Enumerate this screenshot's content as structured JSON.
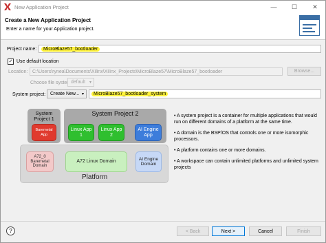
{
  "window": {
    "title": "New Application Project",
    "controls": [
      "—",
      "☐",
      "✕"
    ]
  },
  "header": {
    "title": "Create a New Application Project",
    "subtitle": "Enter a name for your Application project."
  },
  "form": {
    "project_name_label": "Project name:",
    "project_name_value": "MicroBlaze57_bootloader",
    "use_default_location_label": "Use default location",
    "use_default_location_checked": true,
    "location_label": "Location:",
    "location_value": "C:\\Users\\rynea\\Documents\\Xilinx\\Xilinx_Projects\\MicroBlaze57\\MicroBlaze57_bootloader",
    "browse_label": "Browse...",
    "file_system_label": "Choose file system:",
    "file_system_value": "default",
    "system_project_label": "System project:",
    "system_project_select": "Create New...",
    "system_project_value": "MicroBlaze57_bootloader_system"
  },
  "diagram": {
    "system_project_1": "System Project 1",
    "system_project_2": "System Project 2",
    "baremetal_app": "Baremetal App",
    "linux_app_1": "Linux App 1",
    "linux_app_2": "Linux App 2",
    "ai_engine_app": "AI Engine App",
    "a72_baremetal_domain": "A72_0 Baremetal Domain",
    "a72_linux_domain": "A72 Linux Domain",
    "ai_engine_domain": "AI Engine Domain",
    "platform": "Platform"
  },
  "bullets": [
    "• A system project is a container for multiple applications that would run on different domains of a platform at the same time.",
    "• A domain is the BSP/OS that controls one or more isomorphic processors.",
    "• A platform contains one or more domains.",
    "• A workspace can contain unlimited platforms and unlimited system projects"
  ],
  "footer": {
    "help": "?",
    "back": "< Back",
    "next": "Next >",
    "cancel": "Cancel",
    "finish": "Finish"
  },
  "colors": {
    "highlight": "#fff23a",
    "accent": "#0078d7"
  }
}
